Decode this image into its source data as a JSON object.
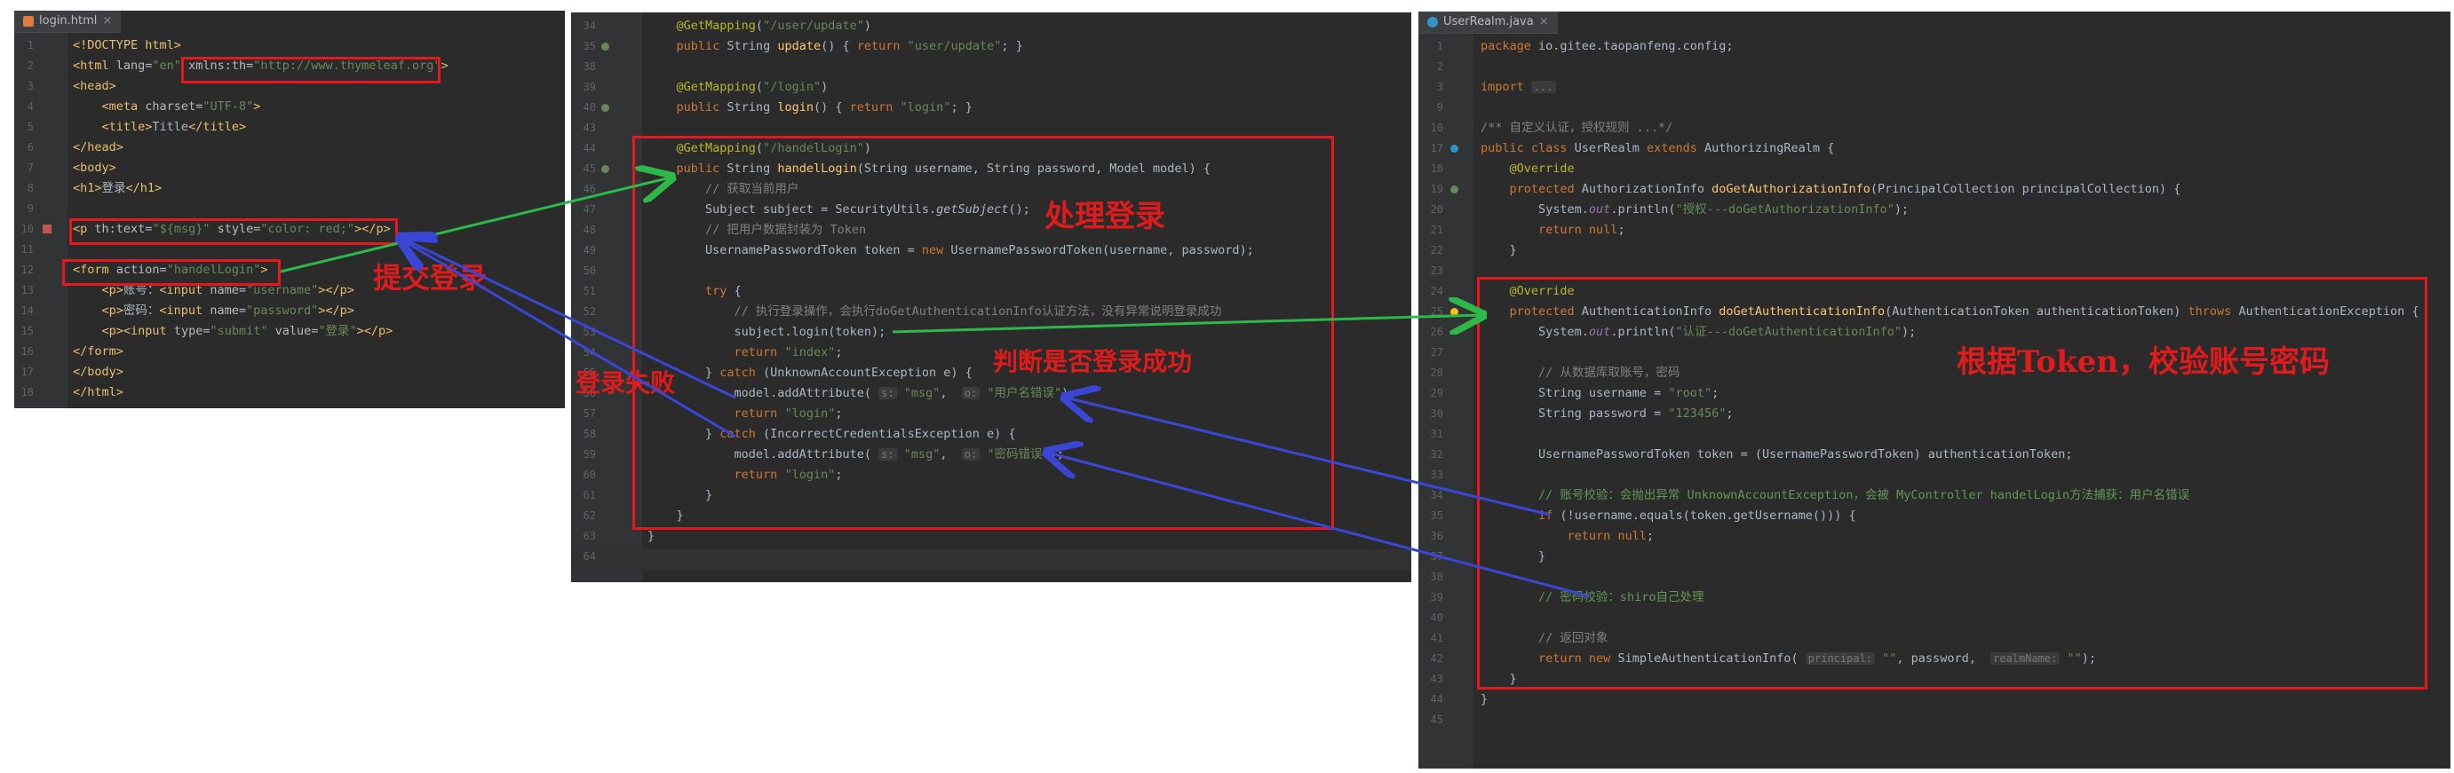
{
  "colors": {
    "editor_bg": "#2b2b2b",
    "annotation_red": "#e5181e",
    "arrow_green": "#2db84a",
    "arrow_blue": "#3a46d6"
  },
  "panel_left": {
    "tab": {
      "icon": "html-file-icon",
      "title": "login.html",
      "close": "×"
    },
    "lines": [
      {
        "n": "1",
        "html": "<span class=\"tag\">&lt;!DOCTYPE html&gt;</span>"
      },
      {
        "n": "2",
        "html": "<span class=\"tag\">&lt;html</span> <span class=\"attr\">lang=</span><span class=\"str\">\"en\"</span> <span class=\"attr\">xmlns:th=</span><span class=\"str\">\"http://www.thymeleaf.org\"</span><span class=\"tag\">&gt;</span>"
      },
      {
        "n": "3",
        "html": "<span class=\"tag\">&lt;head&gt;</span>"
      },
      {
        "n": "4",
        "html": "    <span class=\"tag\">&lt;meta</span> <span class=\"attr\">charset=</span><span class=\"str\">\"UTF-8\"</span><span class=\"tag\">&gt;</span>"
      },
      {
        "n": "5",
        "html": "    <span class=\"tag\">&lt;title&gt;</span>Title<span class=\"tag\">&lt;/title&gt;</span>"
      },
      {
        "n": "6",
        "html": "<span class=\"tag\">&lt;/head&gt;</span>"
      },
      {
        "n": "7",
        "html": "<span class=\"tag\">&lt;body&gt;</span>"
      },
      {
        "n": "8",
        "html": "<span class=\"tag\">&lt;h1&gt;</span>登录<span class=\"tag\">&lt;/h1&gt;</span>"
      },
      {
        "n": "9",
        "html": ""
      },
      {
        "n": "10",
        "html": "<span class=\"tag\">&lt;p</span> <span class=\"attr\">th:text=</span><span class=\"str\">\"${msg}\"</span> <span class=\"attr\">style=</span><span class=\"str\">\"color: red;\"</span><span class=\"tag\">&gt;&lt;/p&gt;</span>"
      },
      {
        "n": "11",
        "html": ""
      },
      {
        "n": "12",
        "html": "<span class=\"tag\">&lt;form</span> <span class=\"attr\">action=</span><span class=\"str\">\"handelLogin\"</span><span class=\"tag\">&gt;</span>"
      },
      {
        "n": "13",
        "html": "    <span class=\"tag\">&lt;p&gt;</span>账号：<span class=\"tag\">&lt;input</span> <span class=\"attr\">name=</span><span class=\"str\">\"username\"</span><span class=\"tag\">&gt;&lt;/p&gt;</span>"
      },
      {
        "n": "14",
        "html": "    <span class=\"tag\">&lt;p&gt;</span>密码：<span class=\"tag\">&lt;input</span> <span class=\"attr\">name=</span><span class=\"str\">\"password\"</span><span class=\"tag\">&gt;&lt;/p&gt;</span>"
      },
      {
        "n": "15",
        "html": "    <span class=\"tag\">&lt;p&gt;&lt;input</span> <span class=\"attr\">type=</span><span class=\"str\">\"submit\"</span> <span class=\"attr\">value=</span><span class=\"str\">\"登录\"</span><span class=\"tag\">&gt;&lt;/p&gt;</span>"
      },
      {
        "n": "16",
        "html": "<span class=\"tag\">&lt;/form&gt;</span>"
      },
      {
        "n": "17",
        "html": "<span class=\"tag\">&lt;/body&gt;</span>"
      },
      {
        "n": "18",
        "html": "<span class=\"tag\">&lt;/html&gt;</span>"
      }
    ]
  },
  "panel_mid": {
    "lines": [
      {
        "n": "34",
        "html": "    <span class=\"ann\">@GetMapping</span>(<span class=\"str\">\"/user/update\"</span>)"
      },
      {
        "n": "35",
        "html": "    <span class=\"kw\">public</span> String <span class=\"fn\">update</span>() { <span class=\"kw\">return</span> <span class=\"str\">\"user/update\"</span>; }"
      },
      {
        "n": "38",
        "html": ""
      },
      {
        "n": "39",
        "html": "    <span class=\"ann\">@GetMapping</span>(<span class=\"str\">\"/login\"</span>)"
      },
      {
        "n": "40",
        "html": "    <span class=\"kw\">public</span> String <span class=\"fn\">login</span>() { <span class=\"kw\">return</span> <span class=\"str\">\"login\"</span>; }"
      },
      {
        "n": "43",
        "html": ""
      },
      {
        "n": "44",
        "html": "    <span class=\"ann\">@GetMapping</span>(<span class=\"str\">\"/handelLogin\"</span>)"
      },
      {
        "n": "45",
        "html": "    <span class=\"kw\">public</span> String <span class=\"fn\">handelLogin</span>(String username, String password, Model model) {"
      },
      {
        "n": "46",
        "html": "        <span class=\"cmg\">// 获取当前用户</span>"
      },
      {
        "n": "47",
        "html": "        Subject subject = SecurityUtils.<i>getSubject</i>();"
      },
      {
        "n": "48",
        "html": "        <span class=\"cmg\">// 把用户数据封装为 Token</span>"
      },
      {
        "n": "49",
        "html": "        UsernamePasswordToken token = <span class=\"kw\">new</span> UsernamePasswordToken(username, password);"
      },
      {
        "n": "50",
        "html": ""
      },
      {
        "n": "51",
        "html": "        <span class=\"kw\">try</span> {"
      },
      {
        "n": "52",
        "html": "            <span class=\"cmg\">// 执行登录操作，会执行doGetAuthenticationInfo认证方法，没有异常说明登录成功</span>"
      },
      {
        "n": "53",
        "html": "            subject.login(token);"
      },
      {
        "n": "54",
        "html": "            <span class=\"kw\">return</span> <span class=\"str\">\"index\"</span>;"
      },
      {
        "n": "55",
        "html": "        } <span class=\"kw\">catch</span> (UnknownAccountException e) {"
      },
      {
        "n": "56",
        "html": "            model.addAttribute( <span class=\"hint\">s:</span> <span class=\"str\">\"msg\"</span>,  <span class=\"hint\">o:</span> <span class=\"str\">\"用户名错误\"</span>);"
      },
      {
        "n": "57",
        "html": "            <span class=\"kw\">return</span> <span class=\"str\">\"login\"</span>;"
      },
      {
        "n": "58",
        "html": "        } <span class=\"kw\">catch</span> (IncorrectCredentialsException e) {"
      },
      {
        "n": "59",
        "html": "            model.addAttribute( <span class=\"hint\">s:</span> <span class=\"str\">\"msg\"</span>,  <span class=\"hint\">o:</span> <span class=\"str\">\"密码错误\"</span>);"
      },
      {
        "n": "60",
        "html": "            <span class=\"kw\">return</span> <span class=\"str\">\"login\"</span>;"
      },
      {
        "n": "61",
        "html": "        }"
      },
      {
        "n": "62",
        "html": "    }"
      },
      {
        "n": "63",
        "html": "}"
      },
      {
        "n": "64",
        "html": ""
      }
    ]
  },
  "panel_right": {
    "tab": {
      "icon": "java-class-icon",
      "title": "UserRealm.java",
      "close": "×"
    },
    "lines": [
      {
        "n": "1",
        "html": "<span class=\"kw\">package</span> io.gitee.taopanfeng.config;"
      },
      {
        "n": "2",
        "html": ""
      },
      {
        "n": "3",
        "html": "<span class=\"kw\">import</span> <span class=\"hint\">...</span>"
      },
      {
        "n": "9",
        "html": ""
      },
      {
        "n": "10",
        "html": "<span class=\"cmg\">/** 自定义认证，授权规则 ...*/</span>"
      },
      {
        "n": "17",
        "html": "<span class=\"kw\">public class</span> UserRealm <span class=\"kw\">extends</span> AuthorizingRealm {"
      },
      {
        "n": "18",
        "html": "    <span class=\"ann\">@Override</span>"
      },
      {
        "n": "19",
        "html": "    <span class=\"kw\">protected</span> AuthorizationInfo <span class=\"fn\">doGetAuthorizationInfo</span>(PrincipalCollection principalCollection) {"
      },
      {
        "n": "20",
        "html": "        System.<i style=\"color:#9876aa\">out</i>.println(<span class=\"str\">\"授权---doGetAuthorizationInfo\"</span>);"
      },
      {
        "n": "21",
        "html": "        <span class=\"kw\">return null</span>;"
      },
      {
        "n": "22",
        "html": "    }"
      },
      {
        "n": "23",
        "html": ""
      },
      {
        "n": "24",
        "html": "    <span class=\"ann\">@Override</span>"
      },
      {
        "n": "25",
        "html": "    <span class=\"kw\">protected</span> AuthenticationInfo <span class=\"fn\">doGetAuthenticationInfo</span>(AuthenticationToken authenticationToken) <span class=\"kw\">throws</span> AuthenticationException {"
      },
      {
        "n": "26",
        "html": "        System.<i style=\"color:#9876aa\">out</i>.println(<span class=\"str\">\"认证---doGetAuthenticationInfo\"</span>);"
      },
      {
        "n": "27",
        "html": ""
      },
      {
        "n": "28",
        "html": "        <span class=\"cmg\">// 从数据库取账号，密码</span>"
      },
      {
        "n": "29",
        "html": "        String username = <span class=\"str\">\"root\"</span>;"
      },
      {
        "n": "30",
        "html": "        String password = <span class=\"str\">\"123456\"</span>;"
      },
      {
        "n": "31",
        "html": ""
      },
      {
        "n": "32",
        "html": "        UsernamePasswordToken token = (UsernamePasswordToken) authenticationToken;"
      },
      {
        "n": "33",
        "html": ""
      },
      {
        "n": "34",
        "html": "        <span class=\"cm\">// 账号校验：会抛出异常 UnknownAccountException，会被 MyController handelLogin方法捕获：用户名错误</span>"
      },
      {
        "n": "35",
        "html": "        <span class=\"kw\">if</span> (!username.equals(token.getUsername())) {"
      },
      {
        "n": "36",
        "html": "            <span class=\"kw\">return null</span>;"
      },
      {
        "n": "37",
        "html": "        }"
      },
      {
        "n": "38",
        "html": ""
      },
      {
        "n": "39",
        "html": "        <span class=\"cm\">// 密码校验：shiro自己处理</span>"
      },
      {
        "n": "40",
        "html": ""
      },
      {
        "n": "41",
        "html": "        <span class=\"cmg\">// 返回对象</span>"
      },
      {
        "n": "42",
        "html": "        <span class=\"kw\">return new</span> SimpleAuthenticationInfo( <span class=\"hint\">principal:</span> <span class=\"str\">\"\"</span>, password,  <span class=\"hint\">realmName:</span> <span class=\"str\">\"\"</span>);"
      },
      {
        "n": "43",
        "html": "    }"
      },
      {
        "n": "44",
        "html": "}"
      },
      {
        "n": "45",
        "html": ""
      }
    ]
  },
  "annotations": {
    "submit_login": "提交登录",
    "login_failed": "登录失败",
    "process_login": "处理登录",
    "check_success": "判断是否登录成功",
    "verify_by_token": "根据Token，校验账号密码"
  }
}
